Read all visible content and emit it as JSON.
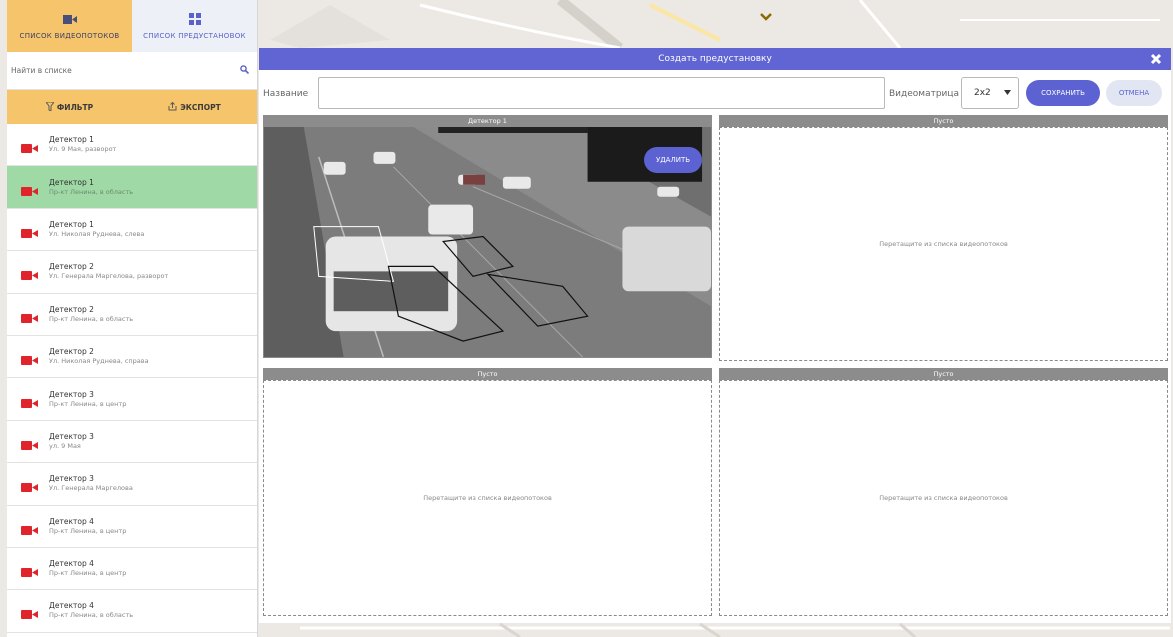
{
  "tabs": [
    {
      "label": "СПИСОК ВИДЕОПОТОКОВ",
      "icon": "video-camera-icon"
    },
    {
      "label": "СПИСОК ПРЕДУСТАНОВОК",
      "icon": "grid-icon"
    }
  ],
  "search": {
    "placeholder": "Найти в списке"
  },
  "toolbar": {
    "filter_label": "ФИЛЬТР",
    "export_label": "ЭКСПОРТ"
  },
  "streams": [
    {
      "title": "Детектор 1",
      "subtitle": "Ул. 9 Мая, разворот"
    },
    {
      "title": "Детектор 1",
      "subtitle": "Пр-кт Ленина, в область"
    },
    {
      "title": "Детектор 1",
      "subtitle": "Ул. Николая Руднева, слева"
    },
    {
      "title": "Детектор 2",
      "subtitle": "Ул. Генерала Маргелова, разворот"
    },
    {
      "title": "Детектор 2",
      "subtitle": "Пр-кт Ленина, в область"
    },
    {
      "title": "Детектор 2",
      "subtitle": "Ул. Николая Руднева, справа"
    },
    {
      "title": "Детектор 3",
      "subtitle": "Пр-кт Ленина, в центр"
    },
    {
      "title": "Детектор 3",
      "subtitle": "ул. 9 Мая"
    },
    {
      "title": "Детектор 3",
      "subtitle": "Ул. Генерала Маргелова"
    },
    {
      "title": "Детектор 4",
      "subtitle": "Пр-кт Ленина, в центр"
    },
    {
      "title": "Детектор 4",
      "subtitle": "Пр-кт Ленина, в центр"
    },
    {
      "title": "Детектор 4",
      "subtitle": "Пр-кт Ленина, в область"
    }
  ],
  "dialog": {
    "title": "Создать предустановку",
    "name_label": "Название",
    "name_value": "",
    "matrix_label": "Видеоматрица",
    "matrix_value": "2x2",
    "save_label": "СОХРАНИТЬ",
    "cancel_label": "ОТМЕНА"
  },
  "cells": [
    {
      "header": "Детектор 1",
      "delete_label": "УДАЛИТЬ"
    },
    {
      "header": "Пусто",
      "hint": "Перетащите из списка видеопотоков"
    },
    {
      "header": "Пусто",
      "hint": "Перетащите из списка видеопотоков"
    },
    {
      "header": "Пусто",
      "hint": "Перетащите из списка видеопотоков"
    }
  ],
  "colors": {
    "accent": "#5c62d2",
    "tab_active": "#f6c46a",
    "selected_row": "#9fd9a5",
    "camera_icon": "#e0242b"
  }
}
